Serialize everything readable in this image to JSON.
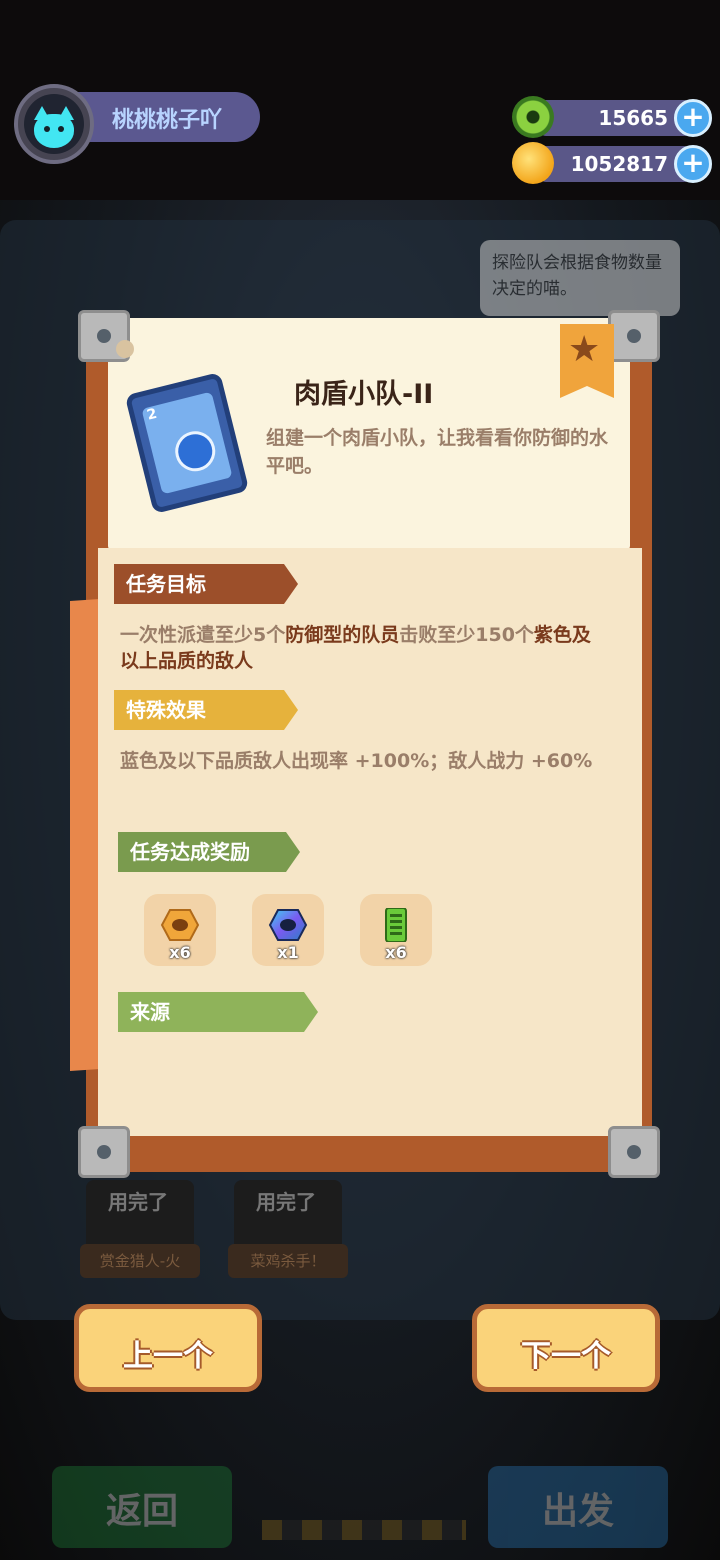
{
  "player": {
    "name": "桃桃桃子吖"
  },
  "currencies": [
    {
      "icon": "green-donut-icon",
      "value": "15665"
    },
    {
      "icon": "gold-planet-coin-icon",
      "value": "1052817"
    }
  ],
  "hint_text": "探险队会根据食物数量决定的喵。",
  "task": {
    "title": "肉盾小队-II",
    "card_level": "2",
    "description": "组建一个肉盾小队，让我看看你防御的水平吧。",
    "objective": {
      "label": "任务目标",
      "part1": "一次性派遣至少5个",
      "highlight1": "防御型的队员",
      "part2": "击败至少150个",
      "highlight2": "紫色及以上品质的敌人"
    },
    "effect": {
      "label": "特殊效果",
      "text": "蓝色及以下品质敌人出现率 +100%；敌人战力 +60%"
    },
    "rewards": {
      "label": "任务达成奖励",
      "items": [
        {
          "icon": "gold-nut-icon",
          "qty": "x6"
        },
        {
          "icon": "rainbow-nut-icon",
          "qty": "x1"
        },
        {
          "icon": "green-battery-icon",
          "qty": "x6"
        }
      ]
    },
    "source": {
      "label": "来源"
    }
  },
  "background_slots": [
    {
      "status": "用完了",
      "name": "赏金猎人-火"
    },
    {
      "status": "用完了",
      "name": "菜鸡杀手！"
    }
  ],
  "nav": {
    "prev": "上一个",
    "next": "下一个"
  },
  "bottom": {
    "back": "返回",
    "go": "出发"
  },
  "colors": {
    "accent_orange": "#b05b2b",
    "paper": "#f6e6c8",
    "plus_blue": "#4aa8ef"
  }
}
